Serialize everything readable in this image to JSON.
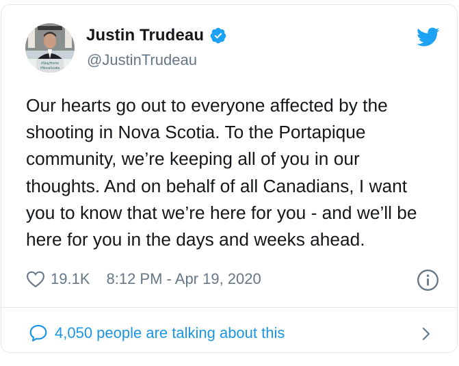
{
  "user": {
    "display_name": "Justin Trudeau",
    "handle": "@JustinTrudeau",
    "avatar_caption": "#StayHome #NovaScotia"
  },
  "tweet": {
    "text": "Our hearts go out to everyone affected by the\nshooting in Nova Scotia. To the Portapique\ncommunity, we’re keeping all of you in our\nthoughts. And on behalf of all Canadians, I want\nyou to know that we’re here for you - and we’ll be\nhere for you in the days and weeks ahead."
  },
  "meta": {
    "likes": "19.1K",
    "timestamp": "8:12 PM - Apr 19, 2020"
  },
  "footer": {
    "talking": "4,050 people are talking about this"
  },
  "colors": {
    "accent": "#1da1f2",
    "link": "#1b95e0",
    "text": "#14171a",
    "muted": "#657786",
    "border": "#e1e8ed"
  },
  "icons": {
    "verified": "verified-badge-icon",
    "brand": "twitter-bird-icon",
    "like": "heart-icon",
    "info": "info-icon",
    "reply": "speech-bubble-icon",
    "more": "chevron-right-icon"
  }
}
